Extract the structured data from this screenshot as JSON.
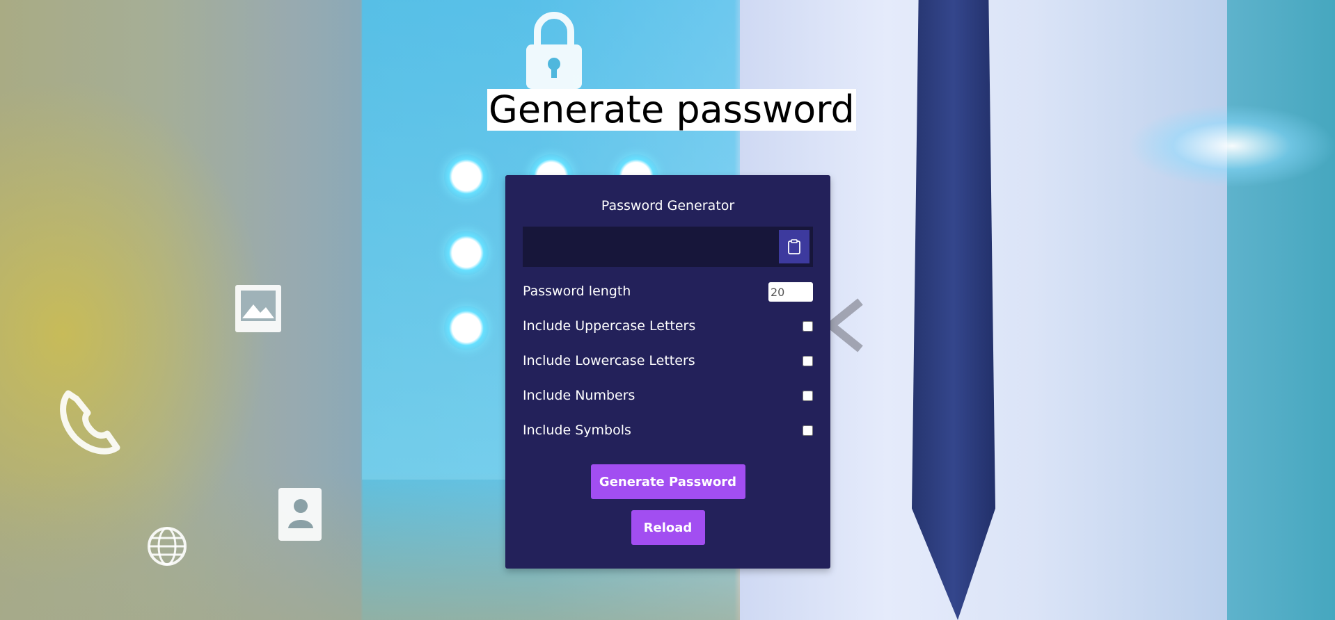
{
  "page": {
    "heading": "Generate password"
  },
  "generator": {
    "title": "Password Generator",
    "result_value": "",
    "clipboard_icon": "clipboard-icon",
    "length": {
      "label": "Password length",
      "value": "20"
    },
    "options": [
      {
        "label": "Include Uppercase Letters",
        "checked": false
      },
      {
        "label": "Include Lowercase Letters",
        "checked": false
      },
      {
        "label": "Include Numbers",
        "checked": false
      },
      {
        "label": "Include Symbols",
        "checked": false
      }
    ],
    "generate_label": "Generate Password",
    "reload_label": "Reload"
  },
  "colors": {
    "card_bg": "#23215a",
    "result_bg": "#17163a",
    "clipboard_btn": "#3d3a9e",
    "button_accent": "#a24ef1"
  }
}
